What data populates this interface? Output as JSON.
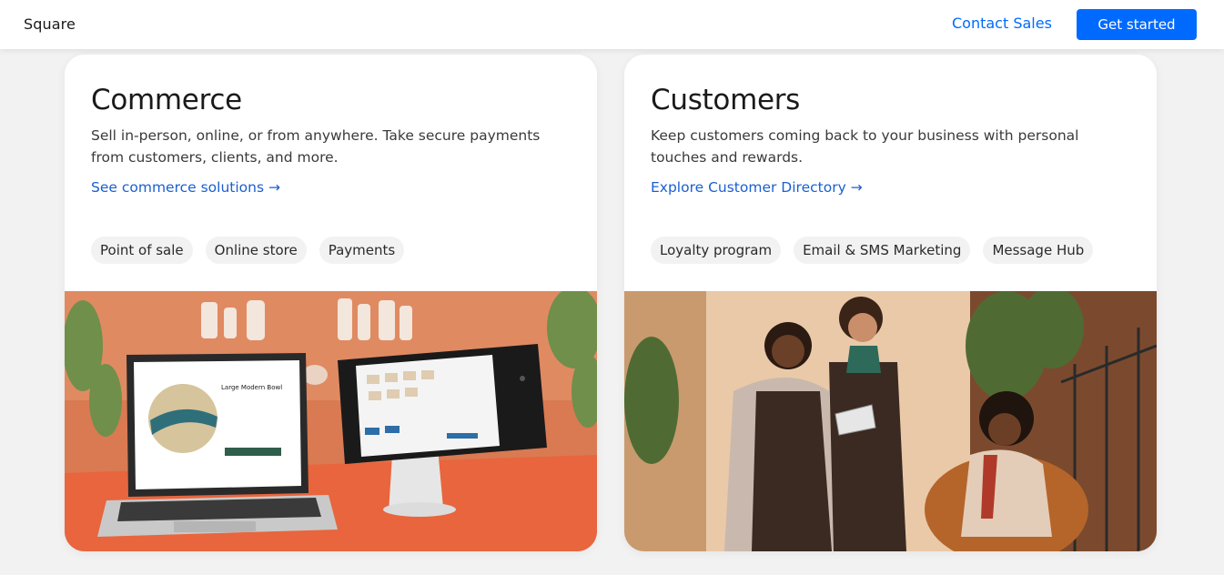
{
  "header": {
    "brand": "Square",
    "contact_label": "Contact Sales",
    "cta_label": "Get started"
  },
  "cards": [
    {
      "title": "Commerce",
      "description": "Sell in-person, online, or from anywhere. Take secure payments from customers, clients, and more.",
      "link_label": "See commerce solutions →",
      "chips": [
        "Point of sale",
        "Online store",
        "Payments"
      ],
      "screen_product": "Large Modern Bowl"
    },
    {
      "title": "Customers",
      "description": "Keep customers coming back to your business with personal touches and rewards.",
      "link_label": "Explore Customer Directory →",
      "chips": [
        "Loyalty program",
        "Email & SMS Marketing",
        "Message Hub"
      ]
    }
  ],
  "colors": {
    "accent": "#006aff",
    "link": "#1a5fd0",
    "background": "#f2f2f2"
  }
}
